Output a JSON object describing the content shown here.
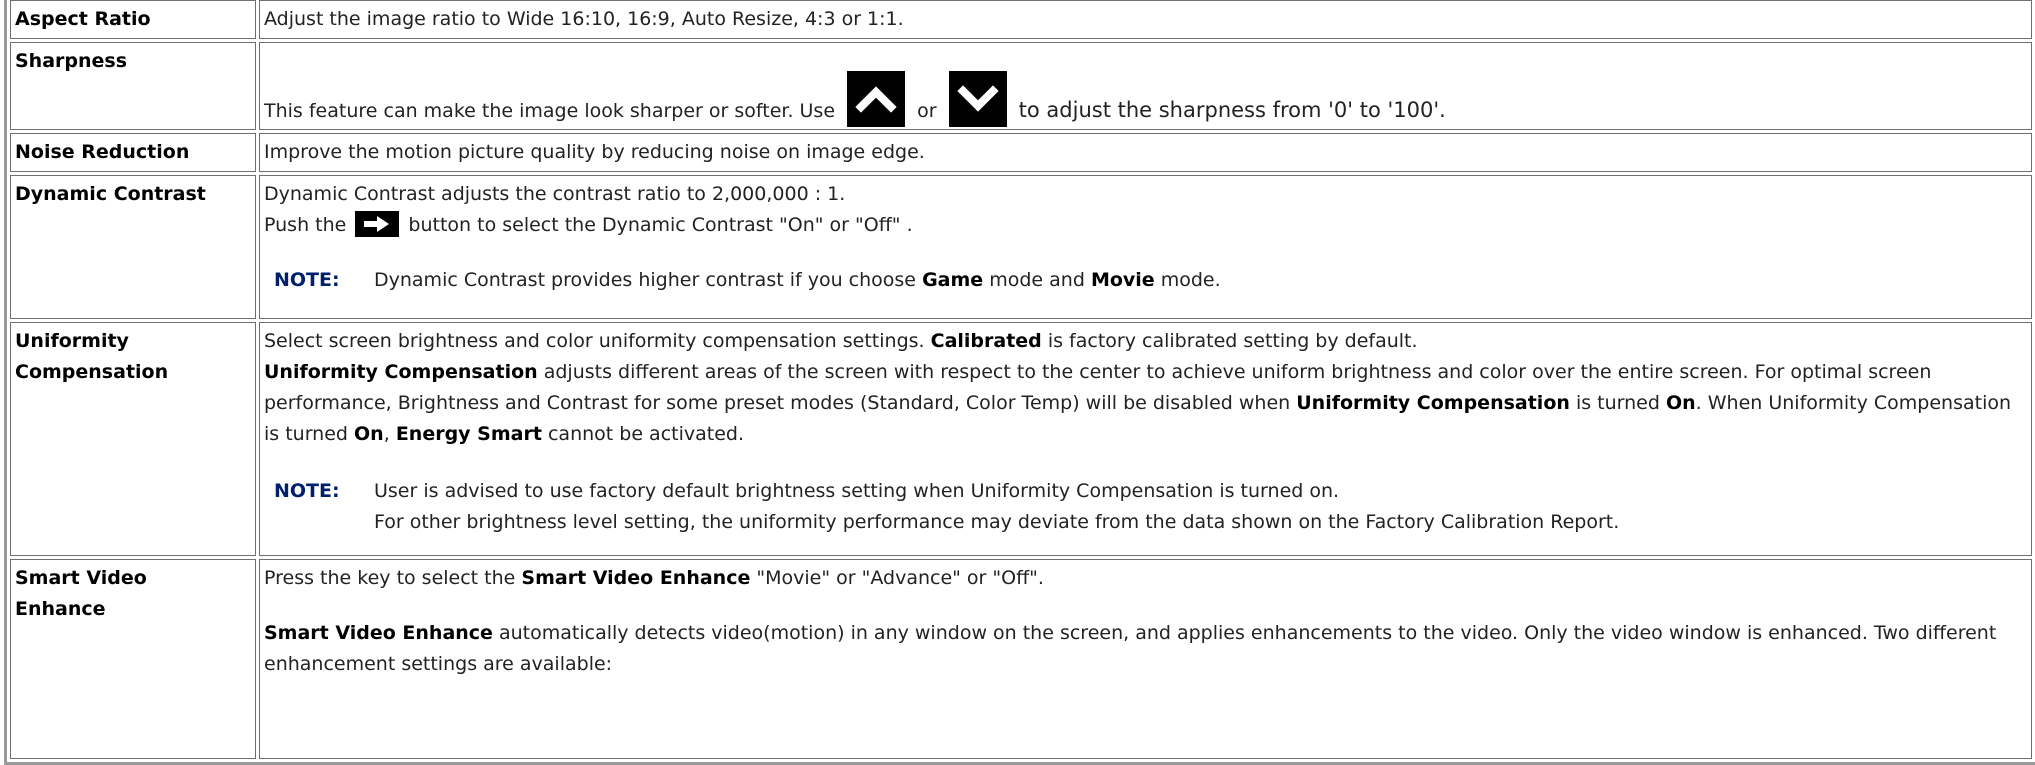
{
  "rows": [
    {
      "label": "Aspect Ratio",
      "text": "Adjust the image ratio to Wide 16:10, 16:9, Auto Resize, 4:3 or 1:1."
    },
    {
      "label": "Sharpness",
      "text_before": "This feature can make the image look sharper or softer. Use",
      "text_or": "or",
      "text_after": "to adjust the sharpness from '0' to '100'."
    },
    {
      "label": "Noise Reduction",
      "text": "Improve the motion picture quality by reducing noise on image edge."
    },
    {
      "label": "Dynamic Contrast",
      "line1": "Dynamic Contrast adjusts the contrast ratio to 2,000,000 : 1.",
      "line2_before": "Push the",
      "line2_after": "button to select the Dynamic Contrast \"On\" or \"Off\" .",
      "note_label": "NOTE:",
      "note_pre": "Dynamic Contrast provides higher contrast if you choose",
      "note_b1": "Game",
      "note_mid": "mode and",
      "note_b2": "Movie",
      "note_post": "mode."
    },
    {
      "label_line1": "Uniformity",
      "label_line2": "Compensation",
      "p1_pre": "Select screen brightness and color uniformity compensation settings.",
      "p1_b": "Calibrated",
      "p1_post": "is factory calibrated setting by default.",
      "p2_b1": "Uniformity Compensation",
      "p2_t1": "adjusts different areas of the screen with respect to the center to achieve uniform brightness and color over the entire screen. For optimal screen performance, Brightness and Contrast for some preset modes (Standard, Color Temp) will be disabled when",
      "p2_b2": "Uniformity Compensation",
      "p2_t2": "is turned",
      "p2_b3": "On",
      "p2_t3": ". When Uniformity Compensation is turned",
      "p2_b4": "On",
      "p2_t4": ",",
      "p2_b5": "Energy Smart",
      "p2_t5": "cannot be activated.",
      "note_label": "NOTE:",
      "note_line1": "User is advised to use factory default brightness setting when Uniformity Compensation is turned on.",
      "note_line2": "For other brightness level setting, the uniformity performance may deviate from the data shown on the Factory Calibration Report."
    },
    {
      "label_line1": "Smart Video",
      "label_line2": "Enhance",
      "p1_pre": "Press the key to select the",
      "p1_b": "Smart Video Enhance",
      "p1_post": "\"Movie\" or \"Advance\" or \"Off\".",
      "p2_b": "Smart Video Enhance",
      "p2_t": "automatically detects video(motion) in any window on the screen, and applies enhancements to the video. Only the video window is enhanced. Two different enhancement settings are available:"
    }
  ],
  "icons": {
    "up": "chevron-up-icon",
    "down": "chevron-down-icon",
    "right": "right-arrow-icon"
  }
}
